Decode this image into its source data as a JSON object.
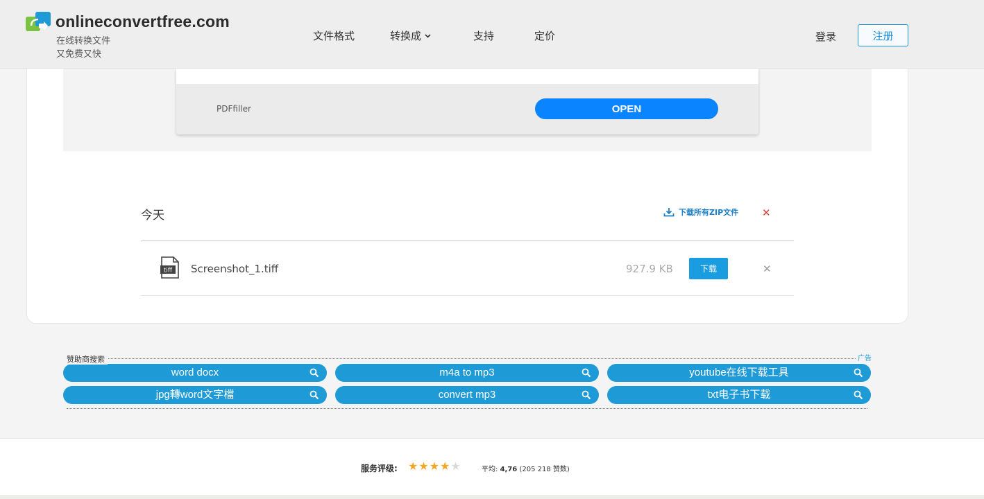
{
  "header": {
    "logo_title": "onlineconvertfree.com",
    "logo_sub1": "在线转换文件",
    "logo_sub2": "又免费又快",
    "nav": {
      "formats": "文件格式",
      "convert": "转换成",
      "support": "支持",
      "pricing": "定价"
    },
    "login": "登录",
    "signup": "注册"
  },
  "ad": {
    "name": "PDFfiller",
    "open_label": "OPEN"
  },
  "files": {
    "section_label": "今天",
    "zip_label": "下载所有ZIP文件",
    "items": [
      {
        "icon_text": "tiff",
        "name": "Screenshot_1.tiff",
        "size": "927.9 KB",
        "download_label": "下载"
      }
    ]
  },
  "sponsor": {
    "title": "赞助商搜索",
    "ad_tag": "广告",
    "pills": [
      "word docx",
      "m4a to mp3",
      "youtube在线下载工具",
      "jpg轉word文字檔",
      "convert mp3",
      "txt电子书下载"
    ]
  },
  "footer": {
    "rating_label": "服务评级:",
    "rating_value": 4.76,
    "stars_max": 5,
    "avg_prefix": "平均:",
    "avg_value": "4,76",
    "avg_votes": "(205 218 赞数)"
  },
  "colors": {
    "accent": "#1a9ce0",
    "open_button": "#0a84ff",
    "close_red": "#e53935",
    "star": "#f5a623"
  }
}
